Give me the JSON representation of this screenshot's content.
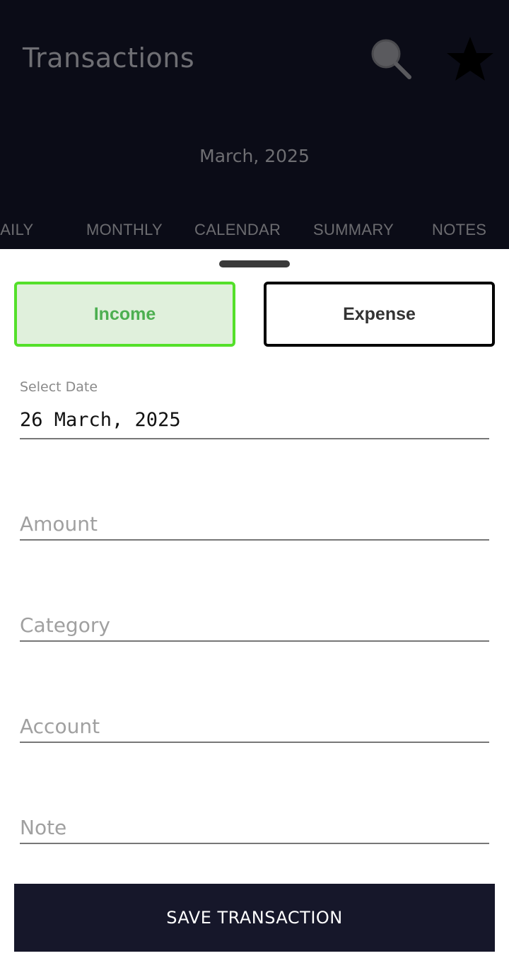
{
  "header": {
    "title": "Transactions",
    "month": "March, 2025",
    "search_icon": "search-icon",
    "star_icon": "star-icon"
  },
  "tabs": [
    {
      "label": "DAILY"
    },
    {
      "label": "MONTHLY"
    },
    {
      "label": "CALENDAR"
    },
    {
      "label": "SUMMARY"
    },
    {
      "label": "NOTES"
    }
  ],
  "sheet": {
    "income_label": "Income",
    "expense_label": "Expense",
    "selected_type": "Income",
    "date_label": "Select Date",
    "date_value": "26 March, 2025",
    "amount_placeholder": "Amount",
    "category_placeholder": "Category",
    "account_placeholder": "Account",
    "note_placeholder": "Note",
    "save_label": "SAVE TRANSACTION"
  },
  "colors": {
    "header_bg": "#0b0c17",
    "income_accent": "#54e02a",
    "income_fill": "#e0f0dc",
    "save_bg": "#16172a"
  }
}
